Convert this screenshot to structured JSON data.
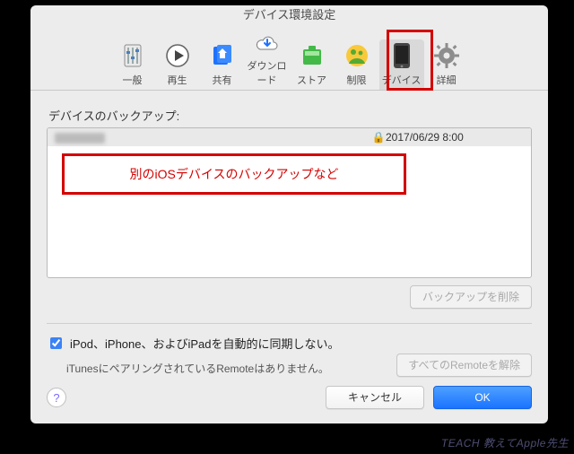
{
  "window": {
    "title": "デバイス環境設定"
  },
  "toolbar": {
    "items": [
      {
        "id": "general",
        "label": "一般"
      },
      {
        "id": "playback",
        "label": "再生"
      },
      {
        "id": "sharing",
        "label": "共有"
      },
      {
        "id": "downloads",
        "label": "ダウンロード"
      },
      {
        "id": "store",
        "label": "ストア"
      },
      {
        "id": "restrictions",
        "label": "制限"
      },
      {
        "id": "devices",
        "label": "デバイス",
        "selected": true
      },
      {
        "id": "advanced",
        "label": "詳細"
      }
    ]
  },
  "content": {
    "backups_label": "デバイスのバックアップ:",
    "backups": [
      {
        "name": "(redacted)",
        "encrypted": true,
        "date": "2017/06/29 8:00",
        "selected": true
      }
    ],
    "annotation_text": "別のiOSデバイスのバックアップなど",
    "delete_backup_btn": "バックアップを削除",
    "prevent_sync_checked": true,
    "prevent_sync_label": "iPod、iPhone、およびiPadを自動的に同期しない。",
    "remote_text": "iTunesにペアリングされているRemoteはありません。",
    "forget_remotes_btn": "すべてのRemoteを解除"
  },
  "footer": {
    "cancel": "キャンセル",
    "ok": "OK"
  },
  "watermark": "TEACH 教えてApple先生"
}
